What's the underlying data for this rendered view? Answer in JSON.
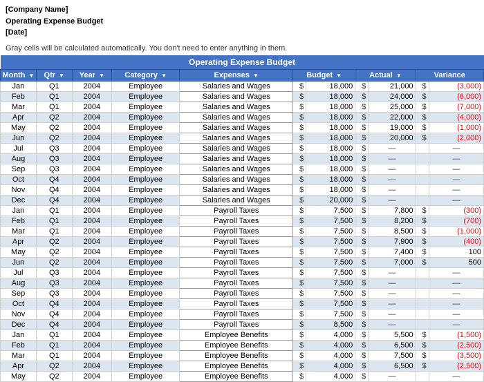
{
  "header": {
    "company": "[Company Name]",
    "title": "Operating Expense Budget",
    "date": "[Date]",
    "note": "Gray cells will be calculated automatically. You don't  need to enter anything in them."
  },
  "table": {
    "title": "Operating Expense Budget",
    "columns": [
      "Month",
      "Qtr",
      "Year",
      "Category",
      "Expenses",
      "Budget",
      "Actual",
      "Variance"
    ],
    "rows": [
      [
        "Jan",
        "Q1",
        "2004",
        "Employee",
        "Salaries and Wages",
        "$",
        "18,000",
        "$",
        "21,000",
        "$",
        "(3,000)"
      ],
      [
        "Feb",
        "Q1",
        "2004",
        "Employee",
        "Salaries and Wages",
        "$",
        "18,000",
        "$",
        "24,000",
        "$",
        "(6,000)"
      ],
      [
        "Mar",
        "Q1",
        "2004",
        "Employee",
        "Salaries and Wages",
        "$",
        "18,000",
        "$",
        "25,000",
        "$",
        "(7,000)"
      ],
      [
        "Apr",
        "Q2",
        "2004",
        "Employee",
        "Salaries and Wages",
        "$",
        "18,000",
        "$",
        "22,000",
        "$",
        "(4,000)"
      ],
      [
        "May",
        "Q2",
        "2004",
        "Employee",
        "Salaries and Wages",
        "$",
        "18,000",
        "$",
        "19,000",
        "$",
        "(1,000)"
      ],
      [
        "Jun",
        "Q2",
        "2004",
        "Employee",
        "Salaries and Wages",
        "$",
        "18,000",
        "$",
        "20,000",
        "$",
        "(2,000)"
      ],
      [
        "Jul",
        "Q3",
        "2004",
        "Employee",
        "Salaries and Wages",
        "$",
        "18,000",
        "$",
        "—",
        "",
        "—"
      ],
      [
        "Aug",
        "Q3",
        "2004",
        "Employee",
        "Salaries and Wages",
        "$",
        "18,000",
        "$",
        "—",
        "",
        "—"
      ],
      [
        "Sep",
        "Q3",
        "2004",
        "Employee",
        "Salaries and Wages",
        "$",
        "18,000",
        "$",
        "—",
        "",
        "—"
      ],
      [
        "Oct",
        "Q4",
        "2004",
        "Employee",
        "Salaries and Wages",
        "$",
        "18,000",
        "$",
        "—",
        "",
        "—"
      ],
      [
        "Nov",
        "Q4",
        "2004",
        "Employee",
        "Salaries and Wages",
        "$",
        "18,000",
        "$",
        "—",
        "",
        "—"
      ],
      [
        "Dec",
        "Q4",
        "2004",
        "Employee",
        "Salaries and Wages",
        "$",
        "20,000",
        "$",
        "—",
        "",
        "—"
      ],
      [
        "Jan",
        "Q1",
        "2004",
        "Employee",
        "Payroll Taxes",
        "$",
        "7,500",
        "$",
        "7,800",
        "$",
        "(300)"
      ],
      [
        "Feb",
        "Q1",
        "2004",
        "Employee",
        "Payroll Taxes",
        "$",
        "7,500",
        "$",
        "8,200",
        "$",
        "(700)"
      ],
      [
        "Mar",
        "Q1",
        "2004",
        "Employee",
        "Payroll Taxes",
        "$",
        "7,500",
        "$",
        "8,500",
        "$",
        "(1,000)"
      ],
      [
        "Apr",
        "Q2",
        "2004",
        "Employee",
        "Payroll Taxes",
        "$",
        "7,500",
        "$",
        "7,900",
        "$",
        "(400)"
      ],
      [
        "May",
        "Q2",
        "2004",
        "Employee",
        "Payroll Taxes",
        "$",
        "7,500",
        "$",
        "7,400",
        "$",
        "100"
      ],
      [
        "Jun",
        "Q2",
        "2004",
        "Employee",
        "Payroll Taxes",
        "$",
        "7,500",
        "$",
        "7,000",
        "$",
        "500"
      ],
      [
        "Jul",
        "Q3",
        "2004",
        "Employee",
        "Payroll Taxes",
        "$",
        "7,500",
        "$",
        "—",
        "",
        "—"
      ],
      [
        "Aug",
        "Q3",
        "2004",
        "Employee",
        "Payroll Taxes",
        "$",
        "7,500",
        "$",
        "—",
        "",
        "—"
      ],
      [
        "Sep",
        "Q3",
        "2004",
        "Employee",
        "Payroll Taxes",
        "$",
        "7,500",
        "$",
        "—",
        "",
        "—"
      ],
      [
        "Oct",
        "Q4",
        "2004",
        "Employee",
        "Payroll Taxes",
        "$",
        "7,500",
        "$",
        "—",
        "",
        "—"
      ],
      [
        "Nov",
        "Q4",
        "2004",
        "Employee",
        "Payroll Taxes",
        "$",
        "7,500",
        "$",
        "—",
        "",
        "—"
      ],
      [
        "Dec",
        "Q4",
        "2004",
        "Employee",
        "Payroll Taxes",
        "$",
        "8,500",
        "$",
        "—",
        "",
        "—"
      ],
      [
        "Jan",
        "Q1",
        "2004",
        "Employee",
        "Employee Benefits",
        "$",
        "4,000",
        "$",
        "5,500",
        "$",
        "(1,500)"
      ],
      [
        "Feb",
        "Q1",
        "2004",
        "Employee",
        "Employee Benefits",
        "$",
        "4,000",
        "$",
        "6,500",
        "$",
        "(2,500)"
      ],
      [
        "Mar",
        "Q1",
        "2004",
        "Employee",
        "Employee Benefits",
        "$",
        "4,000",
        "$",
        "7,500",
        "$",
        "(3,500)"
      ],
      [
        "Apr",
        "Q2",
        "2004",
        "Employee",
        "Employee Benefits",
        "$",
        "4,000",
        "$",
        "6,500",
        "$",
        "(2,500)"
      ],
      [
        "May",
        "Q2",
        "2004",
        "Employee",
        "Employee Benefits",
        "$",
        "4,000",
        "$",
        "—",
        "",
        "—"
      ]
    ]
  }
}
